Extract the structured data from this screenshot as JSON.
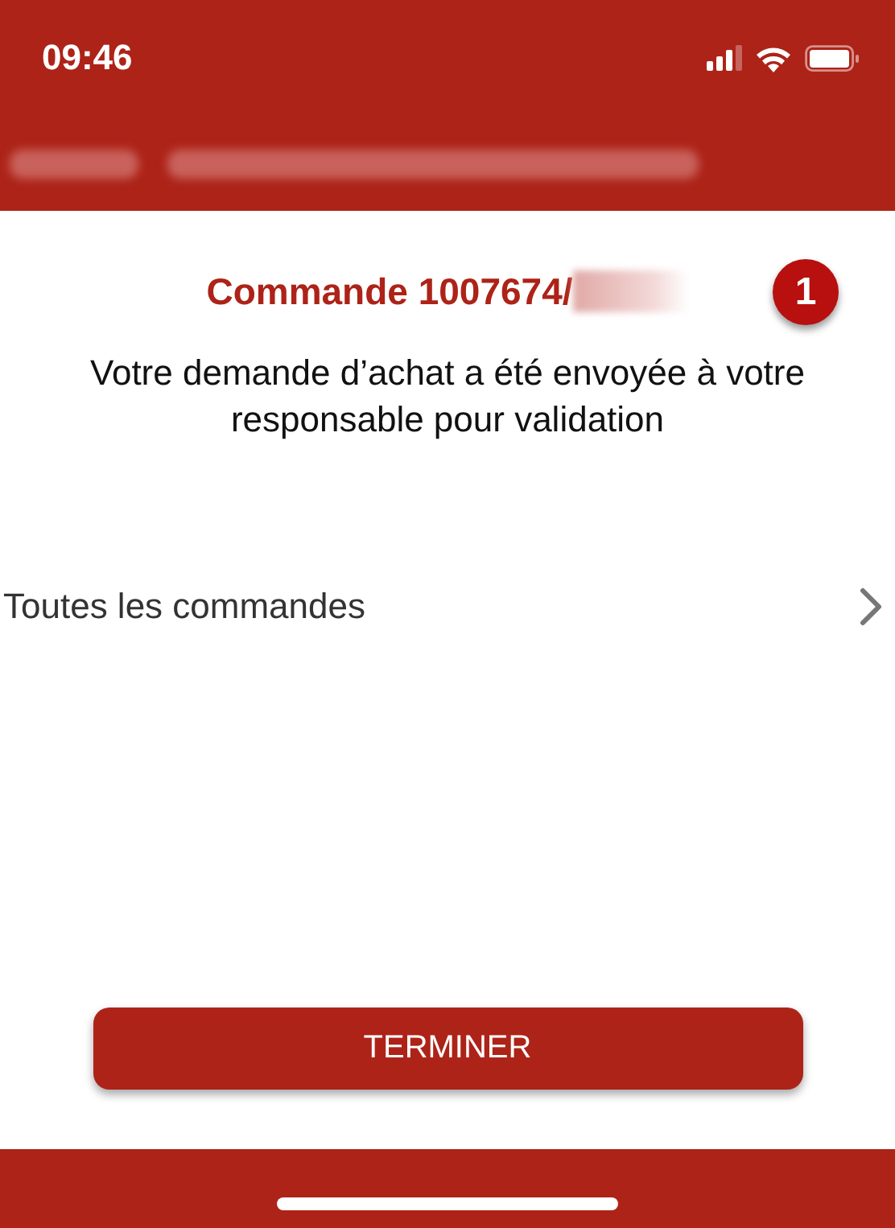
{
  "status_bar": {
    "time": "09:46"
  },
  "order": {
    "title": "Commande 1007674/",
    "badge": "1",
    "message": "Votre demande d’achat a été envoyée à votre responsable pour validation"
  },
  "links": [
    {
      "label": "Toutes les commandes"
    }
  ],
  "buttons": [
    {
      "label": "TERMINER"
    }
  ]
}
